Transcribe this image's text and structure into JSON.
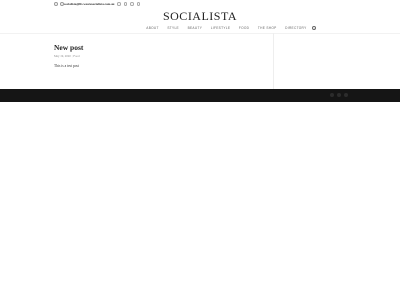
{
  "header": {
    "email": "socialista@lfs.wearesocialista.com.au",
    "brand": "SOCIALISTA",
    "top_icons": [
      "phone-icon",
      "mail-icon"
    ],
    "social_icons": [
      "facebook-icon",
      "twitter-icon",
      "instagram-icon",
      "pinterest-icon"
    ]
  },
  "nav": {
    "items": [
      "ABOUT",
      "STYLE",
      "BEAUTY",
      "LIFESTYLE",
      "FOOD",
      "THE SHOP",
      "DIRECTORY"
    ],
    "search_icon": "search-icon"
  },
  "post": {
    "title": "New post",
    "date": "May 19, 2020",
    "category": "Food",
    "body": "This is a test post"
  },
  "footer": {
    "icons": [
      "facebook-icon",
      "twitter-icon",
      "instagram-icon"
    ],
    "background": "#151515"
  }
}
